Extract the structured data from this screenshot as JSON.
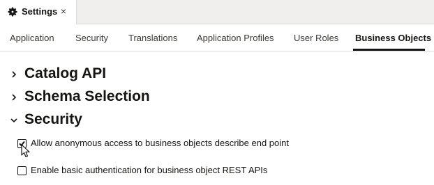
{
  "window_tab": {
    "title": "Settings",
    "close_glyph": "×",
    "icon": "gear-icon"
  },
  "subtabs": [
    {
      "label": "Application",
      "active": false
    },
    {
      "label": "Security",
      "active": false
    },
    {
      "label": "Translations",
      "active": false
    },
    {
      "label": "Application Profiles",
      "active": false
    },
    {
      "label": "User Roles",
      "active": false
    },
    {
      "label": "Business Objects",
      "active": true
    }
  ],
  "sections": [
    {
      "title": "Catalog API",
      "expanded": false
    },
    {
      "title": "Schema Selection",
      "expanded": false
    },
    {
      "title": "Security",
      "expanded": true
    }
  ],
  "security": {
    "options": [
      {
        "label": "Allow anonymous access to business objects describe end point",
        "checked": true
      },
      {
        "label": "Enable basic authentication for business object REST APIs",
        "checked": false
      }
    ]
  },
  "colors": {
    "text": "#161513",
    "tabstrip_bg": "#f1efed",
    "border": "#dcdad7",
    "active_underline": "#161513"
  }
}
